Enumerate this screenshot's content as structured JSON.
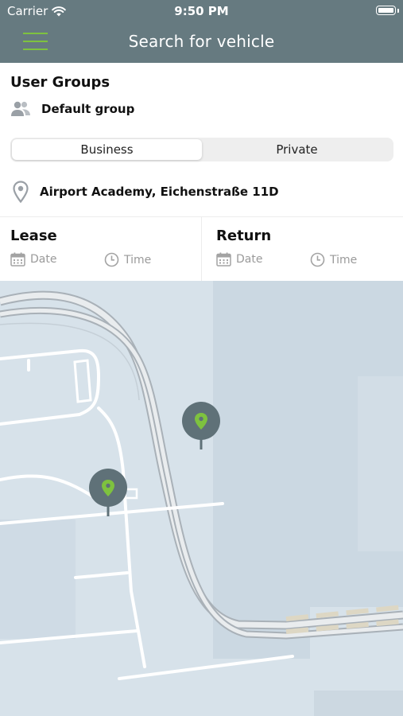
{
  "status_bar": {
    "carrier": "Carrier",
    "time": "9:50 PM"
  },
  "header": {
    "title": "Search for vehicle"
  },
  "user_groups": {
    "heading": "User Groups",
    "group_name": "Default group"
  },
  "trip_type": {
    "options": [
      "Business",
      "Private"
    ],
    "selected": "Business"
  },
  "location": {
    "address": "Airport Academy, Eichenstraße 11D"
  },
  "lease": {
    "heading": "Lease",
    "date_placeholder": "Date",
    "time_placeholder": "Time"
  },
  "return": {
    "heading": "Return",
    "date_placeholder": "Date",
    "time_placeholder": "Time"
  },
  "colors": {
    "header_bg": "#667a80",
    "accent_green": "#7ec23f",
    "pin_bg": "#5f7178",
    "map_bg": "#d7e2ea"
  },
  "icons": [
    "menu-icon",
    "wifi-icon",
    "battery-icon",
    "users-icon",
    "location-pin-icon",
    "calendar-icon",
    "clock-icon",
    "map-marker-icon"
  ]
}
